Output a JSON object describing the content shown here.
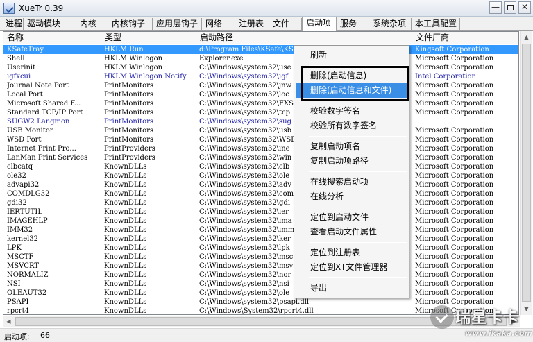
{
  "window": {
    "title": "XueTr 0.39",
    "minimize": "—",
    "close": "✕"
  },
  "tabs": [
    "进程",
    "驱动模块",
    "内核",
    "内核钩子",
    "应用层钩子",
    "网络",
    "注册表",
    "文件",
    "启动项",
    "服务",
    "系统杂项",
    "本工具配置"
  ],
  "active_tab": "启动项",
  "columns": [
    "名称",
    "类型",
    "启动路径",
    "文件厂商"
  ],
  "rows": [
    {
      "name": "KSafeTray",
      "type": "HKLM Run",
      "path": "d:\\Program Files\\KSafe\\KS...",
      "vendor": "Kingsoft Corporation",
      "selected": true
    },
    {
      "name": "Shell",
      "type": "HKLM Winlogon",
      "path": "Explorer.exe",
      "vendor": "Microsoft Corporation"
    },
    {
      "name": "Userinit",
      "type": "HKLM Winlogon",
      "path": "C:\\Windows\\system32\\use",
      "vendor": "Microsoft Corporation"
    },
    {
      "name": "igfxcui",
      "type": "HKLM Winlogon Notify",
      "path": "C:\\Windows\\system32\\igf",
      "vendor": "Intel Corporation",
      "blue": true
    },
    {
      "name": "Journal Note Port",
      "type": "PrintMonitors",
      "path": "C:\\Windows\\system32\\jnw",
      "vendor": "Microsoft Corporation"
    },
    {
      "name": "Local Port",
      "type": "PrintMonitors",
      "path": "C:\\Windows\\system32\\loc",
      "vendor": "Microsoft Corporation"
    },
    {
      "name": "Microsoft Shared F...",
      "type": "PrintMonitors",
      "path": "C:\\Windows\\system32\\FXS",
      "vendor": "Microsoft Corporation"
    },
    {
      "name": "Standard TCP/IP Port",
      "type": "PrintMonitors",
      "path": "C:\\Windows\\system32\\tcp",
      "vendor": "Microsoft Corporation"
    },
    {
      "name": "SUGW2 Langmon",
      "type": "PrintMonitors",
      "path": "C:\\Windows\\system32\\sug",
      "vendor": "",
      "blue": true
    },
    {
      "name": "USB Monitor",
      "type": "PrintMonitors",
      "path": "C:\\Windows\\system32\\usb",
      "vendor": "Microsoft Corporation"
    },
    {
      "name": "WSD Port",
      "type": "PrintMonitors",
      "path": "C:\\Windows\\system32\\WSD",
      "vendor": "Microsoft Corporation"
    },
    {
      "name": "Internet Print Pro...",
      "type": "PrintProviders",
      "path": "C:\\Windows\\system32\\ine",
      "vendor": "Microsoft Corporation"
    },
    {
      "name": "LanMan Print Services",
      "type": "PrintProviders",
      "path": "C:\\Windows\\system32\\win",
      "vendor": "Microsoft Corporation"
    },
    {
      "name": "clbcatq",
      "type": "KnownDLLs",
      "path": "C:\\Windows\\system32\\clb",
      "vendor": "Microsoft Corporation"
    },
    {
      "name": "ole32",
      "type": "KnownDLLs",
      "path": "C:\\Windows\\system32\\ole",
      "vendor": "Microsoft Corporation"
    },
    {
      "name": "advapi32",
      "type": "KnownDLLs",
      "path": "C:\\Windows\\system32\\adv",
      "vendor": "Microsoft Corporation"
    },
    {
      "name": "COMDLG32",
      "type": "KnownDLLs",
      "path": "C:\\Windows\\system32\\com",
      "vendor": "Microsoft Corporation"
    },
    {
      "name": "gdi32",
      "type": "KnownDLLs",
      "path": "C:\\Windows\\system32\\gdi",
      "vendor": "Microsoft Corporation"
    },
    {
      "name": "IERTUTIL",
      "type": "KnownDLLs",
      "path": "C:\\Windows\\system32\\ier",
      "vendor": "Microsoft Corporation"
    },
    {
      "name": "IMAGEHLP",
      "type": "KnownDLLs",
      "path": "C:\\Windows\\system32\\ima",
      "vendor": "Microsoft Corporation"
    },
    {
      "name": "IMM32",
      "type": "KnownDLLs",
      "path": "C:\\Windows\\system32\\imm",
      "vendor": "Microsoft Corporation"
    },
    {
      "name": "kernel32",
      "type": "KnownDLLs",
      "path": "C:\\Windows\\system32\\ker",
      "vendor": "Microsoft Corporation"
    },
    {
      "name": "LPK",
      "type": "KnownDLLs",
      "path": "C:\\Windows\\system32\\lpk",
      "vendor": "Microsoft Corporation"
    },
    {
      "name": "MSCTF",
      "type": "KnownDLLs",
      "path": "C:\\Windows\\system32\\msc",
      "vendor": "Microsoft Corporation"
    },
    {
      "name": "MSVCRT",
      "type": "KnownDLLs",
      "path": "C:\\Windows\\system32\\msv",
      "vendor": "Microsoft Corporation"
    },
    {
      "name": "NORMALIZ",
      "type": "KnownDLLs",
      "path": "C:\\Windows\\system32\\nor",
      "vendor": "Microsoft Corporation"
    },
    {
      "name": "NSI",
      "type": "KnownDLLs",
      "path": "C:\\Windows\\system32\\nsi",
      "vendor": "Microsoft Corporation"
    },
    {
      "name": "OLEAUT32",
      "type": "KnownDLLs",
      "path": "C:\\Windows\\system32\\ole",
      "vendor": "Microsoft Corporation"
    },
    {
      "name": "PSAPI",
      "type": "KnownDLLs",
      "path": "C:\\Windows\\system32\\psapi.dll",
      "vendor": "Microsoft Corporation"
    },
    {
      "name": "rpcrt4",
      "type": "KnownDLLs",
      "path": "C:\\Windows\\System32\\rpcrt4.dll",
      "vendor": "Microsoft Corporation"
    }
  ],
  "context_menu": [
    {
      "label": "刷新"
    },
    {
      "sep": true
    },
    {
      "label": "删除(启动信息)"
    },
    {
      "label": "删除(启动信息和文件)",
      "highlighted": true
    },
    {
      "sep": true
    },
    {
      "label": "校验数字签名"
    },
    {
      "label": "校验所有数字签名"
    },
    {
      "sep": true
    },
    {
      "label": "复制启动项名"
    },
    {
      "label": "复制启动项路径"
    },
    {
      "sep": true
    },
    {
      "label": "在线搜索启动项"
    },
    {
      "label": "在线分析"
    },
    {
      "sep": true
    },
    {
      "label": "定位到启动文件"
    },
    {
      "label": "查看启动文件属性"
    },
    {
      "sep": true
    },
    {
      "label": "定位到注册表"
    },
    {
      "label": "定位到XT文件管理器"
    },
    {
      "sep": true
    },
    {
      "label": "导出"
    }
  ],
  "status": {
    "label": "启动项:",
    "count": "66"
  },
  "watermark": {
    "text": "瑞星卡卡",
    "url": "www.ikaka.com"
  },
  "colors": {
    "selection": "#3399ff",
    "menu_highlight": "#3a8ee6",
    "blue_row_text": "#1a1aa6"
  },
  "icons": {
    "app": "xuetr-app-icon",
    "minimize": "minimize-icon",
    "maximize": "maximize-icon",
    "close": "close-icon",
    "scroll_up": "scroll-up-arrow-icon",
    "scroll_down": "scroll-down-arrow-icon",
    "scroll_left": "scroll-left-arrow-icon",
    "scroll_right": "scroll-right-arrow-icon"
  }
}
